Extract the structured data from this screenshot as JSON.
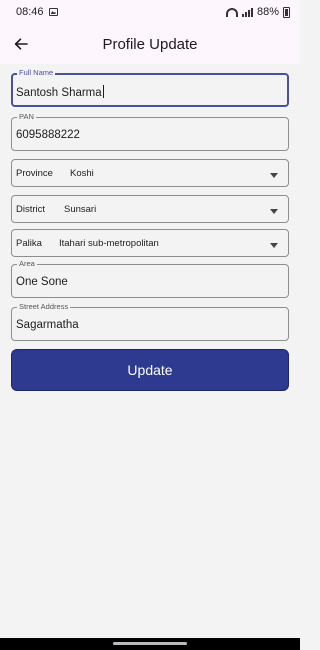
{
  "status_bar": {
    "time": "08:46",
    "battery": "88%",
    "icons": [
      "image-icon",
      "wifi-icon",
      "signal-icon",
      "battery-icon"
    ]
  },
  "app_bar": {
    "title": "Profile Update",
    "back_icon": "arrow-left-icon"
  },
  "form": {
    "full_name": {
      "label": "Full Name",
      "value": "Santosh Sharma"
    },
    "pan": {
      "label": "PAN",
      "value": "6095888222"
    },
    "province": {
      "label": "Province",
      "value": "Koshi"
    },
    "district": {
      "label": "District",
      "value": "Sunsari"
    },
    "palika": {
      "label": "Palika",
      "value": "Itahari sub-metropolitan"
    },
    "area": {
      "label": "Area",
      "value": "One Sone"
    },
    "street": {
      "label": "Street Address",
      "value": "Sagarmatha"
    }
  },
  "actions": {
    "update_label": "Update"
  },
  "colors": {
    "accent": "#4a4f9e",
    "button": "#2e3a8f",
    "background": "#f3f3f3",
    "app_bar": "#fdf7fd"
  }
}
